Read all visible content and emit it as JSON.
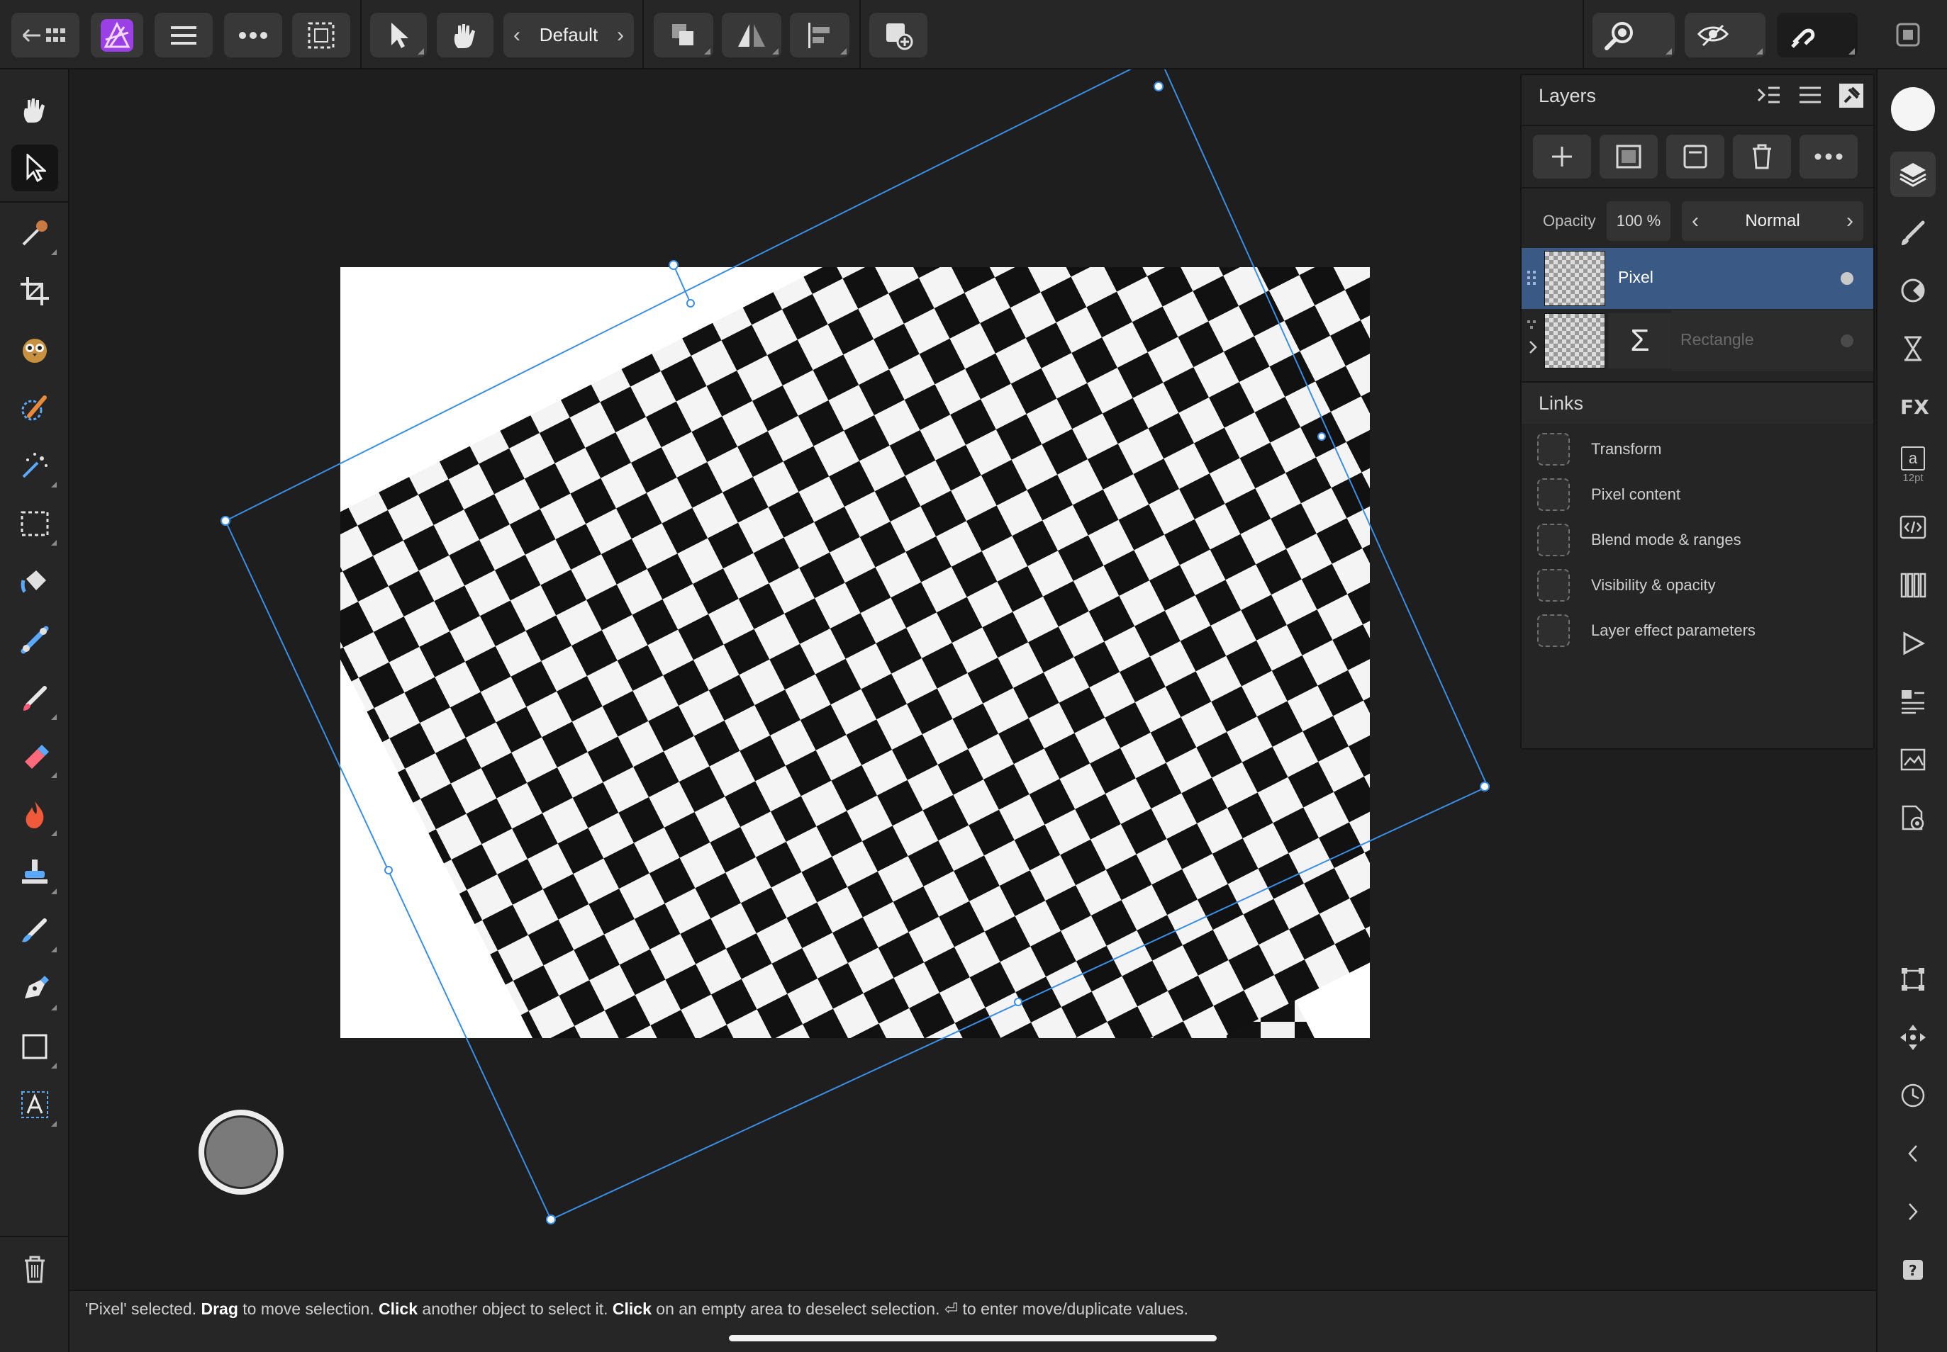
{
  "toolbar": {
    "preset_label": "Default",
    "icons": [
      "back-to-grid-icon",
      "affinity-photo-logo",
      "menu-icon",
      "more-icon",
      "selection-icon",
      "move-tool-icon",
      "snap-hand-icon",
      "arrange-icon",
      "flip-icon",
      "align-icon",
      "add-icon",
      "zoom-icon",
      "view-mode-icon",
      "snapping-magnet-icon",
      "window-icon"
    ]
  },
  "layers": {
    "title": "Layers",
    "opacity_label": "Opacity",
    "opacity_value": "100 %",
    "blend_mode": "Normal",
    "items": [
      {
        "name": "Pixel",
        "selected": true
      },
      {
        "name": "Rectangle",
        "selected": false,
        "symbol": "Σ"
      }
    ]
  },
  "links": {
    "title": "Links",
    "items": [
      "Transform",
      "Pixel content",
      "Blend mode & ranges",
      "Visibility & opacity",
      "Layer effect parameters"
    ]
  },
  "studio": {
    "character_size": "12pt",
    "character_glyph": "a"
  },
  "status": {
    "p1": "'Pixel' selected. ",
    "b1": "Drag",
    "p2": " to move selection. ",
    "b2": "Click",
    "p3": " another object to select it. ",
    "b3": "Click",
    "p4": " on an empty area to deselect selection. ⏎ to enter move/duplicate values."
  },
  "colors": {
    "accent": "#3a5a85",
    "selection": "#3a8ee6",
    "brand": "#a64dff"
  }
}
